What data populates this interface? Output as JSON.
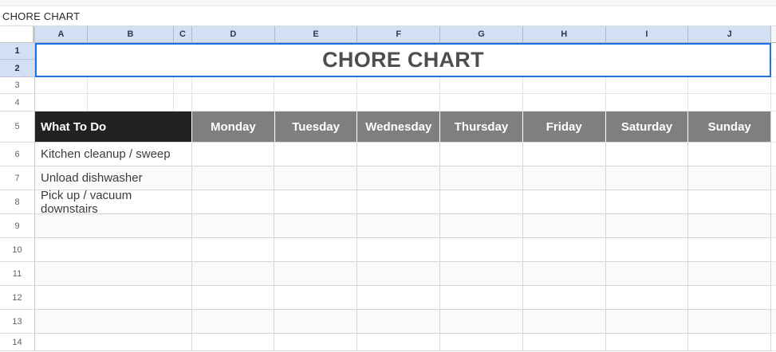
{
  "window": {
    "title": "CHORE CHART"
  },
  "colors": {
    "sel_bg": "#d3e0f4",
    "sel_border": "#1a73e8",
    "day_bg": "#7f7f7f",
    "dark_bg": "#212121",
    "band_bg": "#fafafa"
  },
  "sheet": {
    "columns": [
      "A",
      "B",
      "C",
      "D",
      "E",
      "F",
      "G",
      "H",
      "I",
      "J"
    ],
    "rows": [
      "1",
      "2",
      "3",
      "4",
      "5",
      "6",
      "7",
      "8",
      "9",
      "10",
      "11",
      "12",
      "13",
      "14"
    ],
    "title_cell": "CHORE CHART",
    "table": {
      "task_header": "What To Do",
      "days": [
        "Monday",
        "Tuesday",
        "Wednesday",
        "Thursday",
        "Friday",
        "Saturday",
        "Sunday"
      ],
      "chores": [
        "Kitchen cleanup / sweep",
        "Unload dishwasher",
        "Pick up / vacuum downstairs"
      ]
    }
  }
}
